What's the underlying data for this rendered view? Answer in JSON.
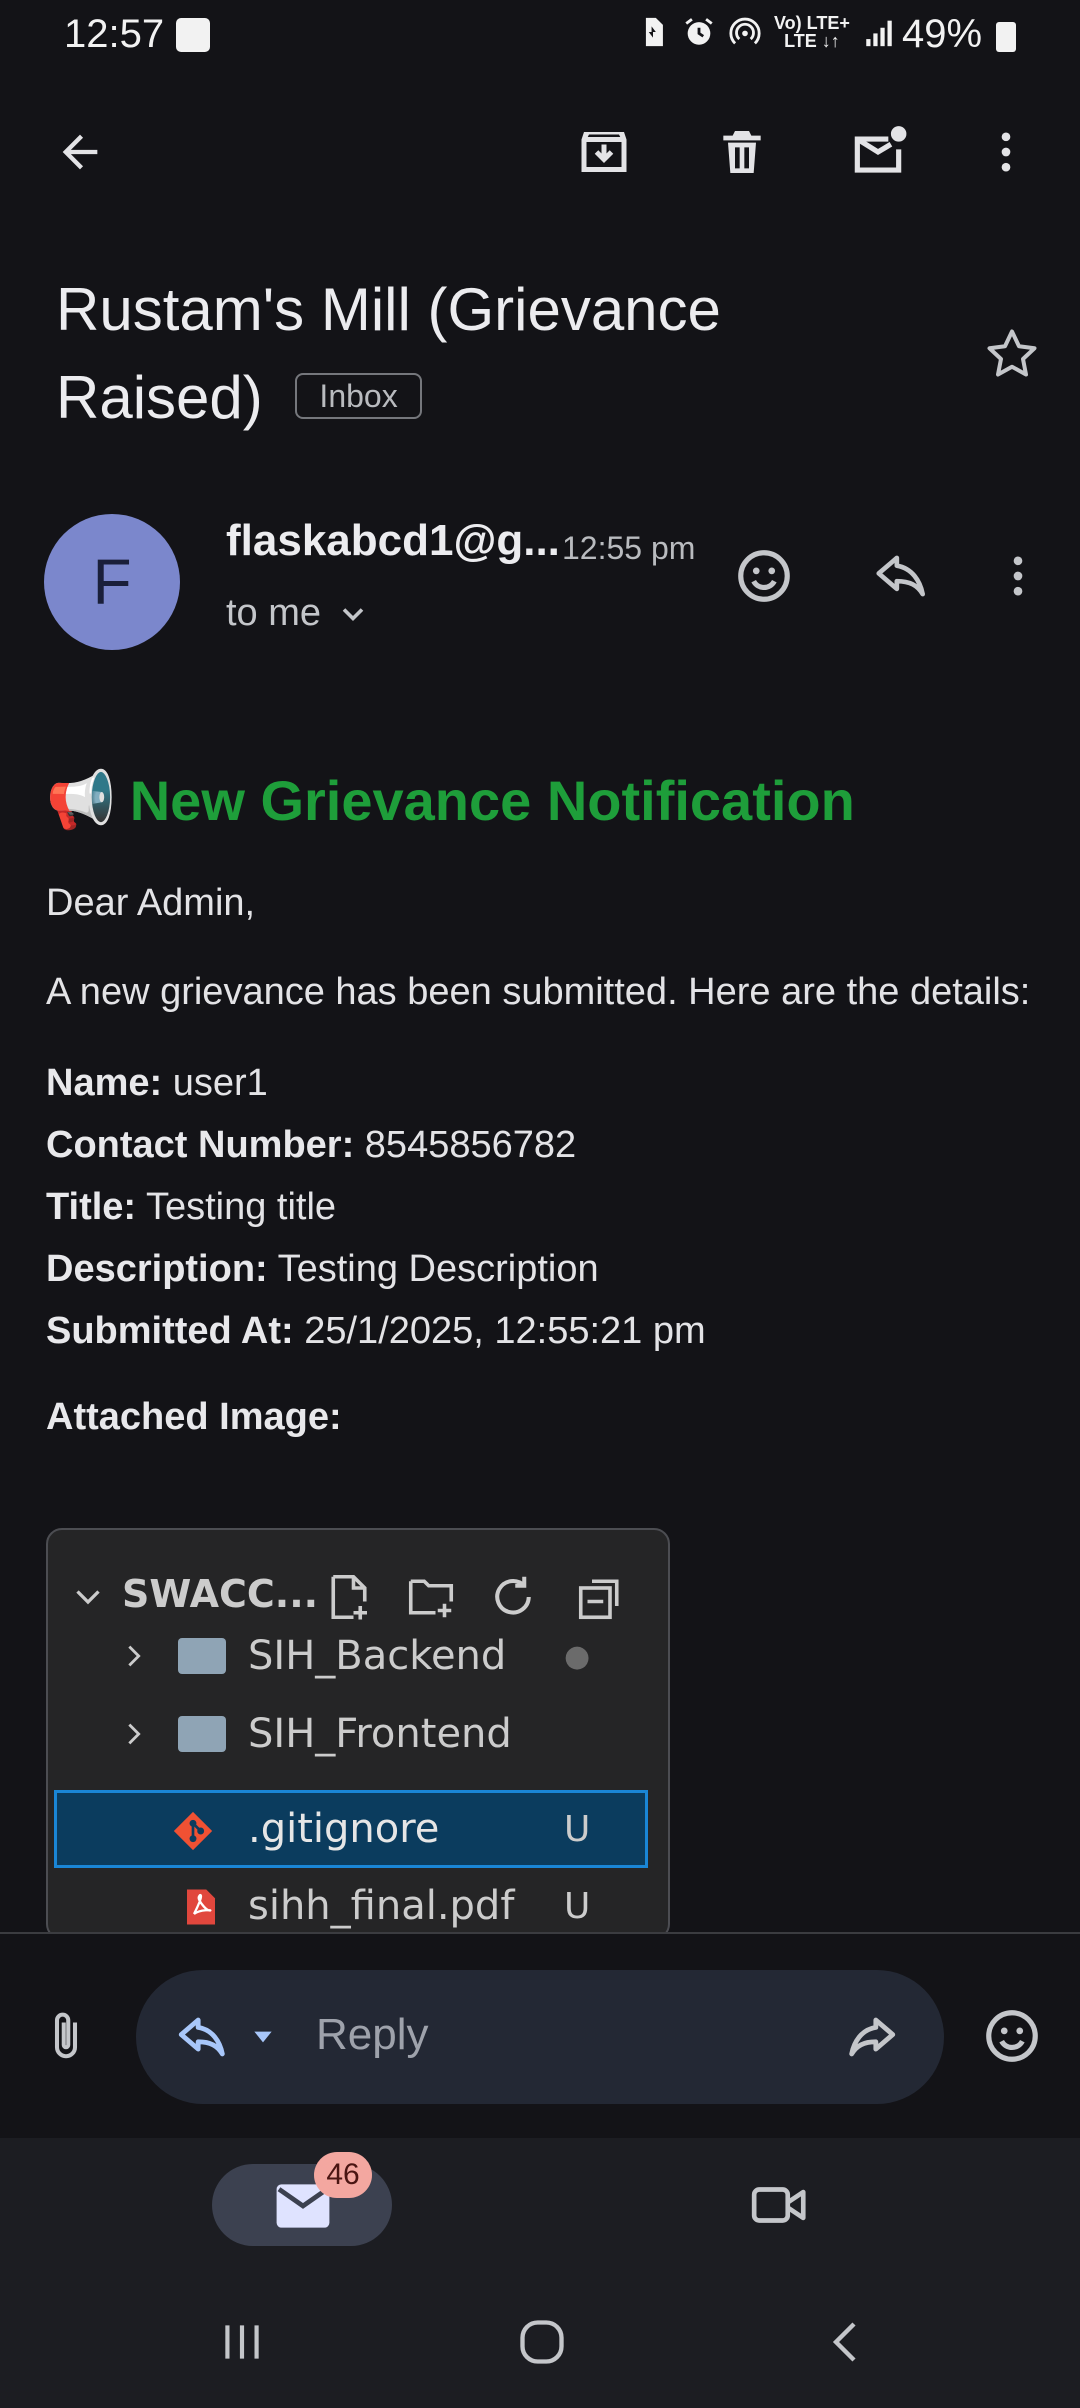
{
  "status_bar": {
    "time": "12:57",
    "net_label_top": "Vo) LTE+",
    "net_label_bottom": "LTE ↓↑",
    "battery": "49%"
  },
  "subject": {
    "title": "Rustam's Mill (Grievance Raised)",
    "label": "Inbox"
  },
  "sender": {
    "initial": "F",
    "name": "flaskabcd1@g...",
    "time": "12:55 pm",
    "to": "to me"
  },
  "body": {
    "heading_icon": "📢",
    "heading": "New Grievance Notification",
    "greeting": "Dear Admin,",
    "intro": "A new grievance has been submitted. Here are the details:",
    "fields": [
      {
        "label": "Name:",
        "value": "user1"
      },
      {
        "label": "Contact Number:",
        "value": "8545856782"
      },
      {
        "label": "Title:",
        "value": "Testing title"
      },
      {
        "label": "Description:",
        "value": "Testing Description"
      },
      {
        "label": "Submitted At:",
        "value": "25/1/2025, 12:55:21 pm"
      }
    ],
    "attached_label": "Attached Image:"
  },
  "attached_image": {
    "explorer_title": "SWACC...",
    "rows": [
      {
        "label": "SIH_Backend",
        "badge": "●"
      },
      {
        "label": "SIH_Frontend",
        "badge": ""
      },
      {
        "label": ".gitignore",
        "badge": "U"
      },
      {
        "label": "sihh_final.pdf",
        "badge": "U"
      }
    ]
  },
  "reply": {
    "placeholder": "Reply"
  },
  "bottom_nav": {
    "mail_count": "46"
  },
  "colors": {
    "background": "#131317",
    "heading_green": "#1e9e3a",
    "avatar": "#7b87cc",
    "badge": "#f3a7a0"
  }
}
